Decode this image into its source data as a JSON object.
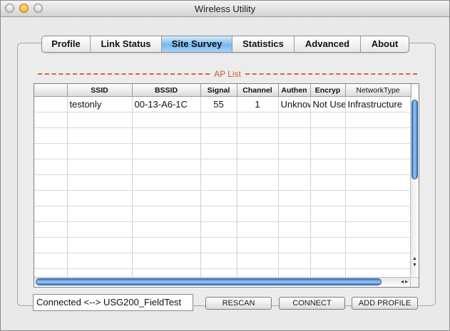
{
  "window": {
    "title": "Wireless Utility"
  },
  "tabs": [
    {
      "label": "Profile"
    },
    {
      "label": "Link Status"
    },
    {
      "label": "Site Survey",
      "active": true
    },
    {
      "label": "Statistics"
    },
    {
      "label": "Advanced"
    },
    {
      "label": "About"
    }
  ],
  "ap_list": {
    "title": "AP List",
    "columns": [
      "",
      "SSID",
      "BSSID",
      "Signal",
      "Channel",
      "Authen",
      "Encryp",
      "NetworkType"
    ],
    "rows": [
      [
        "",
        "testonly",
        "00-13-A6-1C",
        "55",
        "1",
        "Unknow",
        "Not Use",
        "Infrastructure"
      ]
    ],
    "empty_rows": 11
  },
  "footer": {
    "status": "Connected <--> USG200_FieldTest",
    "rescan": "RESCAN",
    "connect": "CONNECT",
    "add_profile": "ADD PROFILE"
  },
  "colors": {
    "accent": "#78b6ee",
    "ap_list_line": "#d26a3a",
    "scroll": "#3c79c6"
  },
  "icons": [
    "close-button-icon",
    "minimize-button-icon",
    "zoom-button-icon"
  ]
}
